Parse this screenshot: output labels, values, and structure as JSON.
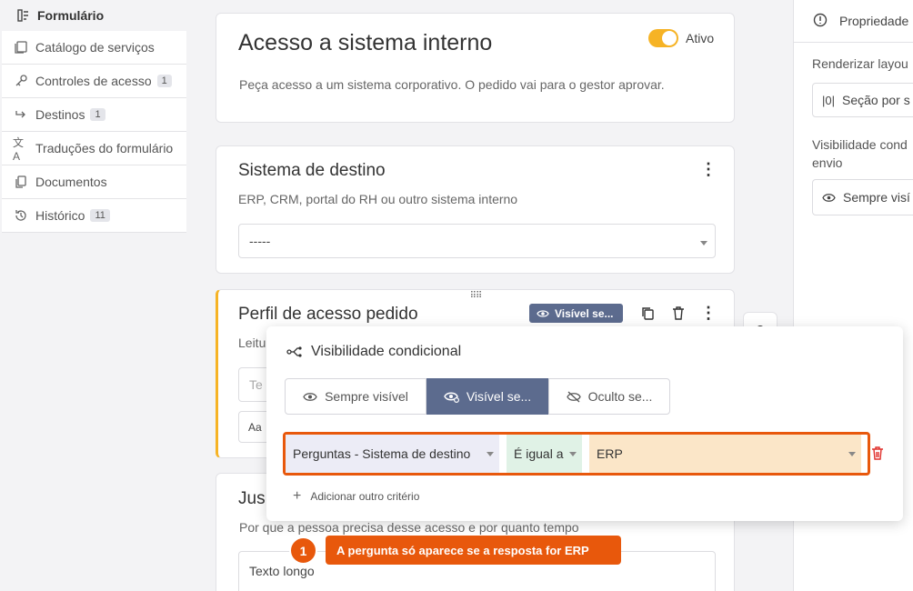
{
  "sidebar": {
    "active_label": "Formulário",
    "items": [
      {
        "label": "Catálogo de serviços",
        "badge": ""
      },
      {
        "label": "Controles de acesso",
        "badge": "1"
      },
      {
        "label": "Destinos",
        "badge": "1"
      },
      {
        "label": "Traduções do formulário",
        "badge": ""
      },
      {
        "label": "Documentos",
        "badge": ""
      },
      {
        "label": "Histórico",
        "badge": "11"
      }
    ]
  },
  "header": {
    "title": "Acesso a sistema interno",
    "toggle_label": "Ativo",
    "toggle_on": true,
    "description": "Peça acesso a um sistema corporativo. O pedido vai para o gestor aprovar."
  },
  "q1": {
    "title": "Sistema de destino",
    "description": "ERP, CRM, portal do RH ou outro sistema interno",
    "select_value": "-----"
  },
  "q2": {
    "title": "Perfil de acesso pedido",
    "desc_partial": "Leitu",
    "input_partial": "Te",
    "visibility_badge": "Visível se...",
    "font_icon_label": "Aa"
  },
  "q3": {
    "title_partial": "Jus",
    "description": "Por que a pessoa precisa desse acesso e por quanto tempo",
    "field_type": "Texto longo"
  },
  "right_panel": {
    "tab_label": "Propriedade",
    "render_layout_label": "Renderizar layou",
    "render_layout_value": "Seção por s",
    "visibility_label_1": "Visibilidade cond",
    "visibility_label_2": "envio",
    "visibility_value": "Sempre visí"
  },
  "popup": {
    "title": "Visibilidade condicional",
    "segments": [
      "Sempre visível",
      "Visível se...",
      "Oculto se..."
    ],
    "active_segment": 1,
    "criterion": {
      "field": "Perguntas - Sistema de destino",
      "operator": "É igual a",
      "value": "ERP"
    },
    "add_criterion": "Adicionar outro critério"
  },
  "callout": {
    "number": "1",
    "text": "A pergunta só aparece se a resposta for ERP"
  },
  "colors": {
    "accent": "#f6b325",
    "active_segment": "#5c6b8e",
    "callout": "#e8580c",
    "delete": "#e0302c"
  }
}
